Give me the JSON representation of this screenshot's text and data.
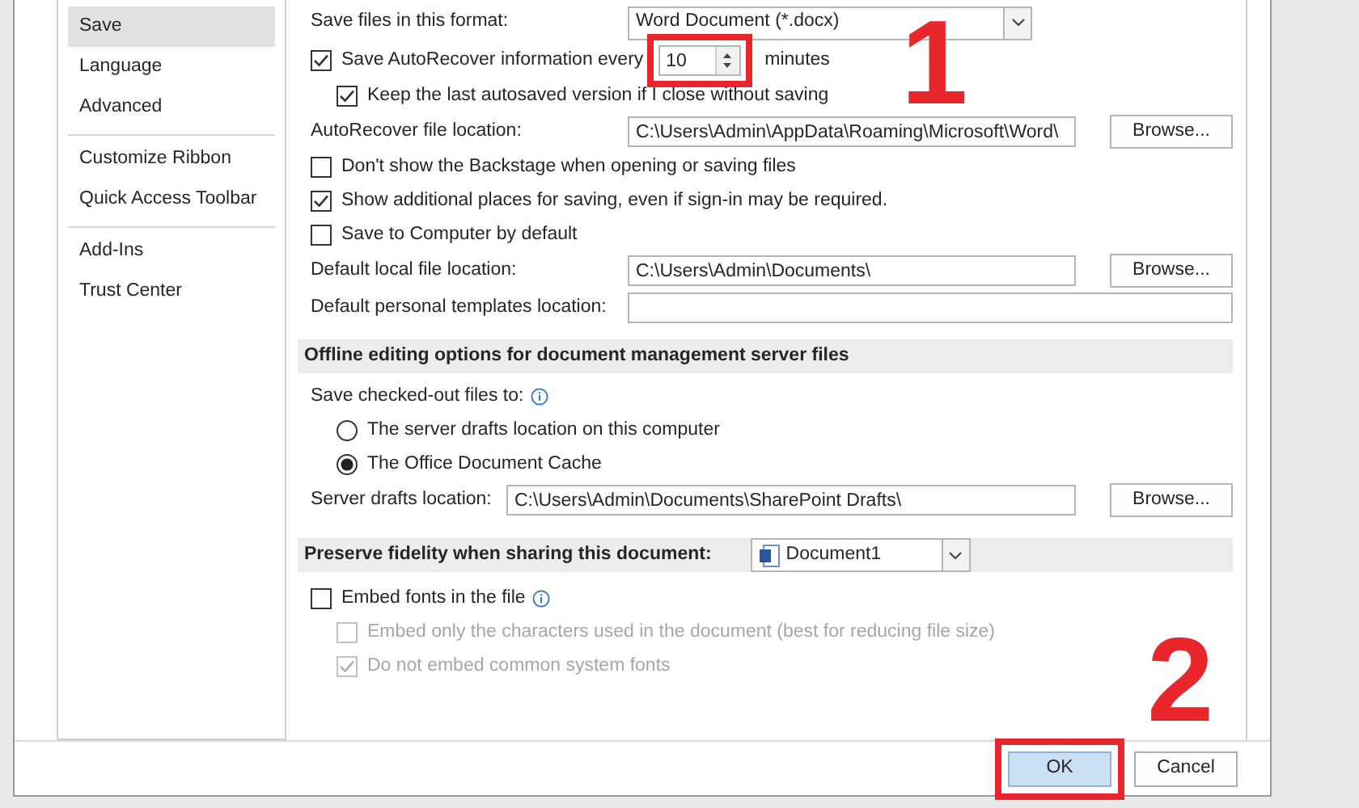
{
  "sidebar": {
    "groups": [
      [
        {
          "label": "Save",
          "selected": true
        },
        {
          "label": "Language",
          "selected": false
        },
        {
          "label": "Advanced",
          "selected": false
        }
      ],
      [
        {
          "label": "Customize Ribbon",
          "selected": false
        },
        {
          "label": "Quick Access Toolbar",
          "selected": false
        }
      ],
      [
        {
          "label": "Add-Ins",
          "selected": false
        },
        {
          "label": "Trust Center",
          "selected": false
        }
      ]
    ]
  },
  "options": [
    {
      "kind": "select",
      "label": "Save files in this format:",
      "value": "Word Document (*.docx)"
    },
    {
      "kind": "spin",
      "label": "Save AutoRecover information every",
      "checked": true,
      "value": "10",
      "unit": "minutes",
      "highlighted": true
    },
    {
      "kind": "checkbox",
      "label": "Keep the last autosaved version if I close without saving",
      "checked": true,
      "indented": true,
      "disabled": false
    },
    {
      "kind": "path",
      "label": "AutoRecover file location:",
      "value": "C:\\Users\\Admin\\AppData\\Roaming\\Microsoft\\Word\\",
      "button": "Browse..."
    },
    {
      "kind": "checkbox",
      "label": "Don't show the Backstage when opening or saving files",
      "checked": false,
      "indented": false,
      "disabled": false
    },
    {
      "kind": "checkbox",
      "label": "Show additional places for saving, even if sign-in may be required.",
      "checked": true,
      "indented": false,
      "disabled": false
    },
    {
      "kind": "checkbox",
      "label": "Save to Computer by default",
      "checked": false,
      "indented": false,
      "disabled": false
    },
    {
      "kind": "path",
      "label": "Default local file location:",
      "value": "C:\\Users\\Admin\\Documents\\",
      "button": "Browse..."
    },
    {
      "kind": "path",
      "label": "Default personal templates location:"
    },
    {
      "kind": "section",
      "title": "Offline editing options for document management server files"
    },
    {
      "kind": "info_label",
      "label": "Save checked-out files to:"
    },
    {
      "kind": "radio",
      "label": "The server drafts location on this computer",
      "selected": false
    },
    {
      "kind": "radio",
      "label": "The Office Document Cache",
      "selected": true
    },
    {
      "kind": "short_path",
      "label": "Server drafts location:",
      "value": "C:\\Users\\Admin\\Documents\\SharePoint Drafts\\",
      "button": "Browse..."
    },
    {
      "kind": "section_select",
      "title": "Preserve fidelity when sharing this document:",
      "value": "Document1"
    },
    {
      "kind": "checkbox",
      "label": "Embed fonts in the file",
      "checked": false,
      "indented": false,
      "disabled": false,
      "info": true
    },
    {
      "kind": "checkbox",
      "label": "Embed only the characters used in the document (best for reducing file size)",
      "checked": false,
      "indented": true,
      "disabled": true
    },
    {
      "kind": "checkbox",
      "label": "Do not embed common system fonts",
      "checked": true,
      "indented": true,
      "disabled": true
    }
  ],
  "buttons": [
    {
      "label": "OK",
      "default": true,
      "highlighted": true
    },
    {
      "label": "Cancel",
      "default": false,
      "highlighted": false
    }
  ],
  "annotations": [
    {
      "label": "1"
    },
    {
      "label": "2"
    }
  ]
}
